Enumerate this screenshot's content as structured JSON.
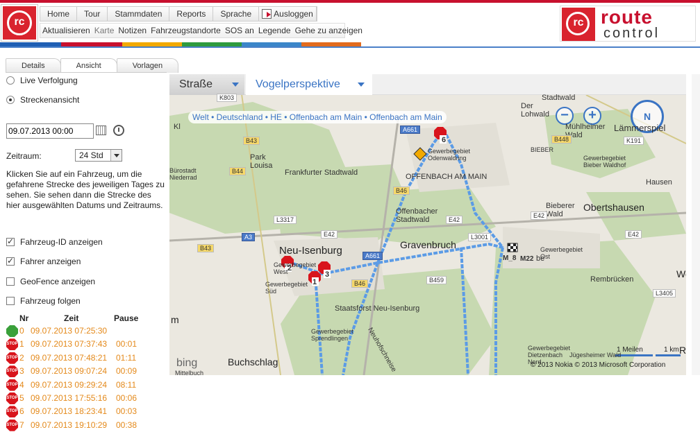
{
  "header": {
    "logo_small": "rc",
    "menu1": [
      "Home",
      "Tour",
      "Stammdaten",
      "Reports",
      "Sprache"
    ],
    "logout": "Ausloggen",
    "menu2": [
      {
        "label": "Aktualisieren",
        "dim": false
      },
      {
        "label": "Karte",
        "dim": true
      },
      {
        "label": "Notizen",
        "dim": false
      },
      {
        "label": "Fahrzeugstandorte",
        "dim": false
      },
      {
        "label": "SOS an",
        "dim": false
      },
      {
        "label": "Legende",
        "dim": false
      },
      {
        "label": "Gehe zu anzeigen",
        "dim": false
      }
    ],
    "brand_mark": "rc",
    "brand_line1": "route",
    "brand_line2": "control",
    "stripe_colors": [
      "#1f5fb4",
      "#c8102e",
      "#f2a900",
      "#2e9b3e",
      "#3b86c9",
      "#e26b1d",
      "#ffffff"
    ]
  },
  "tabs": [
    "Details",
    "Ansicht",
    "Vorlagen"
  ],
  "active_tab": "Ansicht",
  "view": {
    "radio_live": "Live Verfolgung",
    "radio_route": "Streckenansicht",
    "selected": "Streckenansicht",
    "date_value": "09.07.2013 00:00",
    "zeitraum_label": "Zeitraum:",
    "zeitraum_value": "24 Std",
    "help_text": "Klicken Sie auf ein Fahrzeug, um die gefahrene Strecke des jeweiligen Tages zu sehen. Sie sehen dann die Strecke des hier ausgewählten Datums und Zeitraums.",
    "checkboxes": [
      {
        "label": "Fahrzeug-ID anzeigen",
        "checked": true
      },
      {
        "label": "Fahrer anzeigen",
        "checked": true
      },
      {
        "label": "GeoFence anzeigen",
        "checked": false
      },
      {
        "label": "Fahrzeug folgen",
        "checked": false
      }
    ]
  },
  "stops_table": {
    "headers": {
      "nr": "Nr",
      "zeit": "Zeit",
      "pause": "Pause"
    },
    "rows": [
      {
        "icon": "start",
        "nr": "0",
        "zeit": "09.07.2013 07:25:30",
        "pause": ""
      },
      {
        "icon": "stop",
        "nr": "1",
        "zeit": "09.07.2013 07:37:43",
        "pause": "00:01"
      },
      {
        "icon": "stop",
        "nr": "2",
        "zeit": "09.07.2013 07:48:21",
        "pause": "01:11"
      },
      {
        "icon": "stop",
        "nr": "3",
        "zeit": "09.07.2013 09:07:24",
        "pause": "00:09"
      },
      {
        "icon": "stop",
        "nr": "4",
        "zeit": "09.07.2013 09:29:24",
        "pause": "08:11"
      },
      {
        "icon": "stop",
        "nr": "5",
        "zeit": "09.07.2013 17:55:16",
        "pause": "00:06"
      },
      {
        "icon": "stop",
        "nr": "6",
        "zeit": "09.07.2013 18:23:41",
        "pause": "00:03"
      },
      {
        "icon": "stop",
        "nr": "7",
        "zeit": "09.07.2013 19:10:29",
        "pause": "00:38"
      }
    ],
    "stop_icon_text": "STOP"
  },
  "map": {
    "tab_road": "Straße",
    "tab_bird": "Vogelperspektive",
    "breadcrumb": "Welt • Deutschland • HE • Offenbach am Main • Offenbach am Main",
    "compass_label": "N",
    "zoom_out": "−",
    "zoom_in": "+",
    "bing": "bing",
    "copyright": "© 2013 Nokia   © 2013 Microsoft Corporation",
    "scale_miles": "1 Meilen",
    "scale_km": "1 km",
    "route_color": "#5b9be6",
    "labels": {
      "neu_isenburg": "Neu-Isenburg",
      "gravenbruch": "Gravenbruch",
      "obertshausen": "Obertshausen",
      "buchschlag": "Buchschlag",
      "offenbach": "OFFENBACH AM MAIN",
      "frankfurter_stadtwald": "Frankfurter Stadtwald",
      "offenbacher_stadtwald": "Offenbacher Stadtwald",
      "stadtwald_label": "Stadtwald",
      "lohwald": "Der Lohwald",
      "muehlheimer": "Mühlheimer Wald",
      "biebererwald": "Bieberer Wald",
      "rembruecken": "Rembrücken",
      "hausen": "Hausen",
      "park_louisa": "Park Louisa",
      "staatsforst": "Staatsforst Neu-Isenburg",
      "gewerbe_west": "Gewerbegebiet West",
      "gewerbe_sued": "Gewerbegebiet Süd",
      "gewerbe_sprendlingen": "Gewerbegebiet Sprendlingen",
      "gewerbe_dietzenbach": "Gewerbegebiet Dietzenbach Nord",
      "gewerbe_ost": "Gewerbegebiet Ost",
      "gewerbe_oden": "Gewerbegebiet Odenwaldring",
      "gewerbe_bieber": "Gewerbegebiet Bieber Waldhof",
      "buerostadt": "Bürostadt Niederrad",
      "bieber": "BIEBER",
      "jugesheim": "Jügesheimer Wald",
      "neuhofschneise": "Neuhofschneise",
      "laemmerspiel": "Lämmerspiel",
      "m8": "M_8",
      "m22": "M22",
      "marker1": "1",
      "marker2": "2",
      "marker3": "3",
      "marker6": "6",
      "ortsteil_be": "be",
      "wo": "Wo",
      "kl": "Kl",
      "m_left": "m",
      "r_right": "R",
      "mittelbuch": "Mittelbuch"
    },
    "roads": [
      {
        "t": "K803",
        "c": "w"
      },
      {
        "t": "B43",
        "c": "y"
      },
      {
        "t": "B44",
        "c": "y"
      },
      {
        "t": "L3317",
        "c": "w"
      },
      {
        "t": "A3",
        "c": "b"
      },
      {
        "t": "E42",
        "c": "w"
      },
      {
        "t": "B43",
        "c": "y"
      },
      {
        "t": "A661",
        "c": "b"
      },
      {
        "t": "B46",
        "c": "y"
      },
      {
        "t": "B459",
        "c": "w"
      },
      {
        "t": "E42",
        "c": "w"
      },
      {
        "t": "L3001",
        "c": "w"
      },
      {
        "t": "B448",
        "c": "y"
      },
      {
        "t": "K191",
        "c": "w"
      },
      {
        "t": "E42",
        "c": "w"
      },
      {
        "t": "E42",
        "c": "w"
      },
      {
        "t": "L3405",
        "c": "w"
      },
      {
        "t": "A661",
        "c": "b"
      },
      {
        "t": "B46",
        "c": "y"
      }
    ]
  }
}
